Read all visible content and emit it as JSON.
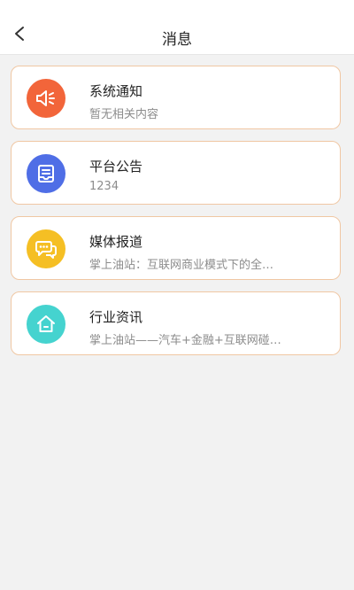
{
  "header": {
    "title": "消息"
  },
  "cards": [
    {
      "title": "系统通知",
      "subtitle": "暂无相关内容",
      "icon": "speaker-icon",
      "color": "#f2653a"
    },
    {
      "title": "平台公告",
      "subtitle": "1234",
      "icon": "announcement-tray-icon",
      "color": "#4f6ee6"
    },
    {
      "title": "媒体报道",
      "subtitle": "掌上油站：互联网商业模式下的全…",
      "icon": "chat-bubble-icon",
      "color": "#f5bf24"
    },
    {
      "title": "行业资讯",
      "subtitle": "掌上油站——汽车+金融+互联网碰…",
      "icon": "house-icon",
      "color": "#45d3cf"
    }
  ]
}
